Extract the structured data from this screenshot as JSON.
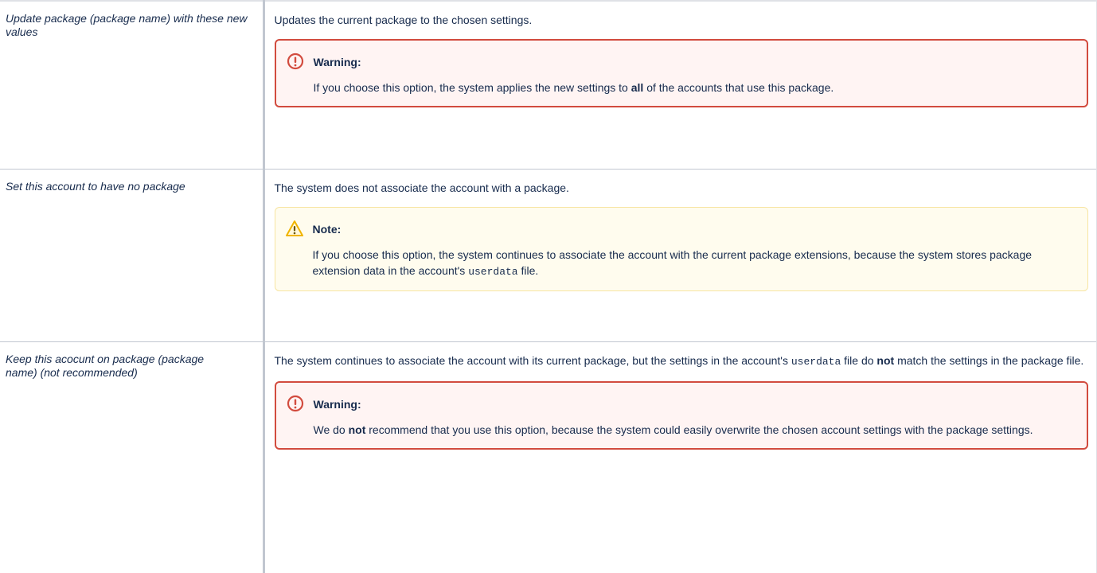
{
  "rows": [
    {
      "option": "Update package (package name) with these new values",
      "description": "Updates the current package to the chosen settings.",
      "panel": {
        "type": "warning",
        "title": "Warning:",
        "parts": [
          "If you choose this option, the system applies the new settings to ",
          "all",
          " of the accounts that use this package."
        ]
      }
    },
    {
      "option": "Set this account to have no package",
      "description": "The system does not associate the account with a package.",
      "panel": {
        "type": "note",
        "title": "Note:",
        "parts": [
          "If you choose this option, the system continues to associate the account with the current package extensions, because the system stores package extension data in the account's ",
          "userdata",
          " file."
        ]
      }
    },
    {
      "option": "Keep this acocunt on package (package name) (not recommended)",
      "description_parts": [
        "The system continues to associate the account with its current package, but the settings in the account's ",
        "userdata",
        " file do ",
        "not",
        " match the settings in the package file."
      ],
      "panel": {
        "type": "warning",
        "title": "Warning:",
        "parts": [
          "We do ",
          "not",
          " recommend that you use this option, because the system could easily overwrite the chosen account settings with the package settings."
        ]
      }
    }
  ],
  "icons": {
    "warning": "warning-circle-icon",
    "note": "warning-triangle-icon"
  },
  "colors": {
    "warning_border": "#d24b3e",
    "warning_bg": "#fff4f3",
    "note_border": "#f7e5a1",
    "note_bg": "#fffcee",
    "note_icon": "#f0b400"
  }
}
